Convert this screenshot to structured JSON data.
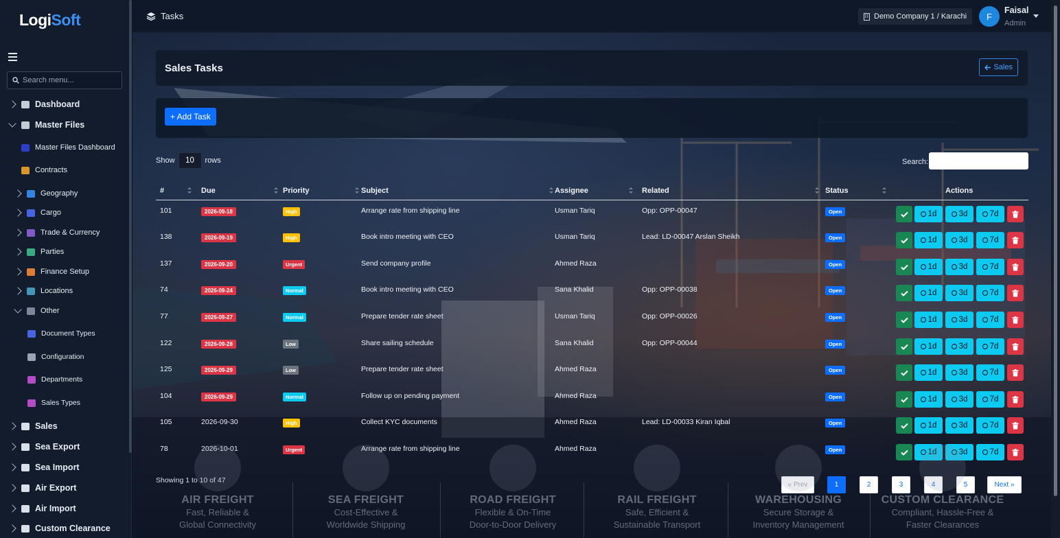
{
  "app": {
    "logo_a": "Logi",
    "logo_b": "Soft",
    "search_placeholder": "Search menu..."
  },
  "sidebar": {
    "items": [
      {
        "label": "Dashboard",
        "level": 0
      },
      {
        "label": "Master Files",
        "level": 0
      },
      {
        "label": "Master Files Dashboard",
        "level": 1
      },
      {
        "label": "Contracts",
        "level": 1
      },
      {
        "label": "Geography",
        "level": 1
      },
      {
        "label": "Cargo",
        "level": 1
      },
      {
        "label": "Trade & Currency",
        "level": 1
      },
      {
        "label": "Parties",
        "level": 1
      },
      {
        "label": "Finance Setup",
        "level": 1
      },
      {
        "label": "Locations",
        "level": 1
      },
      {
        "label": "Other",
        "level": 1
      },
      {
        "label": "Document Types",
        "level": 2
      },
      {
        "label": "Configuration",
        "level": 2
      },
      {
        "label": "Departments",
        "level": 2
      },
      {
        "label": "Sales Types",
        "level": 2
      },
      {
        "label": "Sales",
        "level": 0
      },
      {
        "label": "Sea Export",
        "level": 0
      },
      {
        "label": "Sea Import",
        "level": 0
      },
      {
        "label": "Air Export",
        "level": 0
      },
      {
        "label": "Air Import",
        "level": 0
      },
      {
        "label": "Custom Clearance",
        "level": 0
      }
    ]
  },
  "topbar": {
    "title": "Tasks",
    "company": "Demo Company 1 / Karachi",
    "avatar": "F",
    "user": "Faisal",
    "role": "Admin"
  },
  "page": {
    "title": "Sales Tasks",
    "back_label": "Sales",
    "add_label": "+ Add Task",
    "show_label": "Show",
    "rows_value": "10",
    "rows_label": "rows",
    "search_label": "Search:",
    "footer": "Showing 1 to 10 of 47",
    "pager": {
      "prev": "« Prev",
      "pages": [
        "1",
        "2",
        "3",
        "4",
        "5"
      ],
      "active": "1",
      "next": "Next »"
    }
  },
  "table": {
    "headers": [
      "#",
      "Due",
      "Priority",
      "Subject",
      "Assignee",
      "Related",
      "Status",
      "Actions"
    ],
    "action_labels": {
      "d1": "1d",
      "d3": "3d",
      "d7": "7d"
    },
    "rows": [
      {
        "id": "101",
        "due": "2026-09-18",
        "overdue": true,
        "priority": "High",
        "subject": "Arrange rate from shipping line",
        "assignee": "Usman Tariq",
        "related": "Opp: OPP-00047",
        "status": "Open"
      },
      {
        "id": "138",
        "due": "2026-09-19",
        "overdue": true,
        "priority": "High",
        "subject": "Book intro meeting with CEO",
        "assignee": "Usman Tariq",
        "related": "Lead: LD-00047 Arslan Sheikh",
        "status": "Open"
      },
      {
        "id": "137",
        "due": "2026-09-20",
        "overdue": true,
        "priority": "Urgent",
        "subject": "Send company profile",
        "assignee": "Ahmed Raza",
        "related": "",
        "status": "Open"
      },
      {
        "id": "74",
        "due": "2026-09-24",
        "overdue": true,
        "priority": "Normal",
        "subject": "Book intro meeting with CEO",
        "assignee": "Sana Khalid",
        "related": "Opp: OPP-00038",
        "status": "Open"
      },
      {
        "id": "77",
        "due": "2026-09-27",
        "overdue": true,
        "priority": "Normal",
        "subject": "Prepare tender rate sheet",
        "assignee": "Usman Tariq",
        "related": "Opp: OPP-00026",
        "status": "Open"
      },
      {
        "id": "122",
        "due": "2026-09-28",
        "overdue": true,
        "priority": "Low",
        "subject": "Share sailing schedule",
        "assignee": "Sana Khalid",
        "related": "Opp: OPP-00044",
        "status": "Open"
      },
      {
        "id": "125",
        "due": "2026-09-29",
        "overdue": true,
        "priority": "Low",
        "subject": "Prepare tender rate sheet",
        "assignee": "Ahmed Raza",
        "related": "",
        "status": "Open"
      },
      {
        "id": "104",
        "due": "2026-09-29",
        "overdue": true,
        "priority": "Normal",
        "subject": "Follow up on pending payment",
        "assignee": "Ahmed Raza",
        "related": "",
        "status": "Open"
      },
      {
        "id": "105",
        "due": "2026-09-30",
        "overdue": false,
        "priority": "High",
        "subject": "Collect KYC documents",
        "assignee": "Ahmed Raza",
        "related": "Lead: LD-00033 Kiran Iqbal",
        "status": "Open"
      },
      {
        "id": "78",
        "due": "2026-10-01",
        "overdue": false,
        "priority": "Urgent",
        "subject": "Arrange rate from shipping line",
        "assignee": "Ahmed Raza",
        "related": "",
        "status": "Open"
      }
    ]
  },
  "priority_colors": {
    "High": "#ffc107",
    "Urgent": "#dc3545",
    "Normal": "#0dcaf0",
    "Low": "#6c757d"
  },
  "background": {
    "features": [
      {
        "title": "AIR FREIGHT",
        "line1": "Fast, Reliable &",
        "line2": "Global Connectivity"
      },
      {
        "title": "SEA FREIGHT",
        "line1": "Cost-Effective &",
        "line2": "Worldwide Shipping"
      },
      {
        "title": "ROAD FREIGHT",
        "line1": "Flexible & On-Time",
        "line2": "Door-to-Door Delivery"
      },
      {
        "title": "RAIL FREIGHT",
        "line1": "Safe, Efficient &",
        "line2": "Sustainable Transport"
      },
      {
        "title": "WAREHOUSING",
        "line1": "Secure Storage &",
        "line2": "Inventory Management"
      },
      {
        "title": "CUSTOM CLEARANCE",
        "line1": "Compliant, Hassle-Free &",
        "line2": "Faster Clearances"
      }
    ]
  }
}
